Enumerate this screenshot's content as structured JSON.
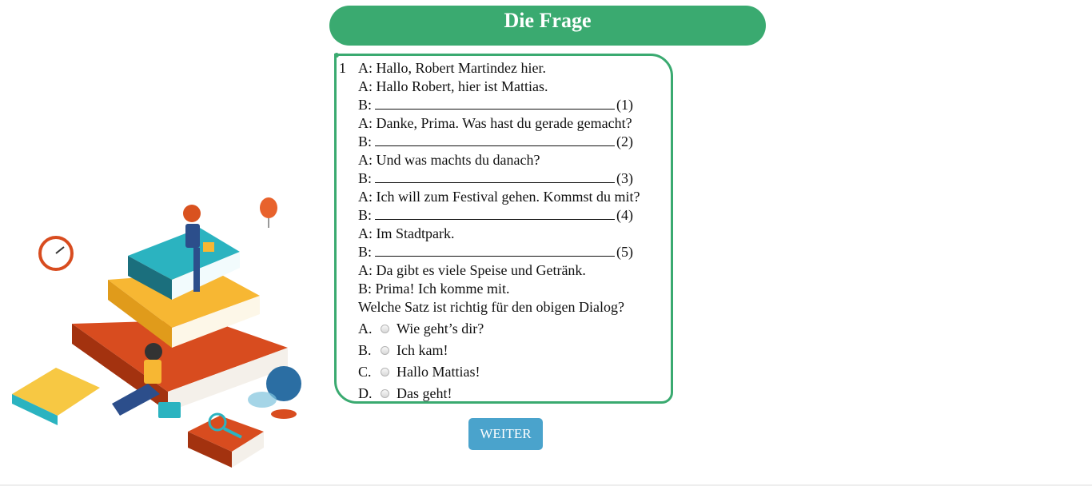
{
  "header": {
    "title": "Die Frage"
  },
  "question": {
    "number": "1",
    "lines": [
      "A: Hallo, Robert Martindez hier.",
      "A: Hallo Robert, hier ist Mattias.",
      {
        "prefix": "B:",
        "suffix": "(1)"
      },
      "A: Danke, Prima. Was hast du gerade gemacht?",
      {
        "prefix": "B:",
        "suffix": "(2)"
      },
      "A: Und was machts du danach?",
      {
        "prefix": "B:",
        "suffix": "(3)"
      },
      "A: Ich will zum Festival gehen. Kommst du mit?",
      {
        "prefix": "B:",
        "suffix": "(4)"
      },
      "A: Im Stadtpark.",
      {
        "prefix": "B:",
        "suffix": "(5)"
      },
      "A: Da gibt es viele Speise und Getränk.",
      "B: Prima! Ich komme mit.",
      "Welche Satz ist richtig für den obigen Dialog?"
    ],
    "options": [
      {
        "letter": "A.",
        "text": "Wie geht’s dir?"
      },
      {
        "letter": "B.",
        "text": "Ich kam!"
      },
      {
        "letter": "C.",
        "text": "Hallo Mattias!"
      },
      {
        "letter": "D.",
        "text": "Das geht!"
      }
    ]
  },
  "button": {
    "label": "WEITER"
  },
  "colors": {
    "accent": "#3aaa70",
    "button": "#4aa3cc"
  },
  "illustration": {
    "name": "books-study-illustration"
  }
}
